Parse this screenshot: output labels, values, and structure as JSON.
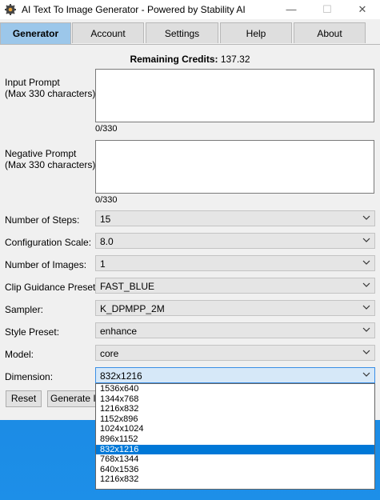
{
  "window": {
    "title": "AI Text To Image Generator - Powered by Stability AI",
    "minimize_glyph": "—",
    "maximize_glyph": "☐",
    "close_glyph": "✕"
  },
  "tabs": [
    {
      "label": "Generator",
      "active": true
    },
    {
      "label": "Account",
      "active": false
    },
    {
      "label": "Settings",
      "active": false
    },
    {
      "label": "Help",
      "active": false
    },
    {
      "label": "About",
      "active": false
    }
  ],
  "credits": {
    "label": "Remaining Credits:",
    "value": "137.32"
  },
  "input_prompt": {
    "label_line1": "Input Prompt",
    "label_line2": "(Max 330 characters):",
    "value": "",
    "counter": "0/330"
  },
  "negative_prompt": {
    "label_line1": "Negative Prompt",
    "label_line2": "(Max 330 characters):",
    "value": "",
    "counter": "0/330"
  },
  "fields": {
    "steps": {
      "label": "Number of Steps:",
      "value": "15"
    },
    "cfg": {
      "label": "Configuration Scale:",
      "value": "8.0"
    },
    "images": {
      "label": "Number of Images:",
      "value": "1"
    },
    "clip": {
      "label": "Clip Guidance Preset:",
      "value": "FAST_BLUE"
    },
    "sampler": {
      "label": "Sampler:",
      "value": "K_DPMPP_2M"
    },
    "style": {
      "label": "Style Preset:",
      "value": "enhance"
    },
    "model": {
      "label": "Model:",
      "value": "core"
    },
    "dimension": {
      "label": "Dimension:",
      "value": "832x1216"
    }
  },
  "buttons": {
    "reset": "Reset",
    "generate": "Generate Im"
  },
  "dimension_options": [
    "1536x640",
    "1344x768",
    "1216x832",
    "1152x896",
    "1024x1024",
    "896x1152",
    "832x1216",
    "768x1344",
    "640x1536",
    "1216x832"
  ],
  "dimension_selected_index": 6,
  "icons": {
    "dropdown": "chevron-down-icon",
    "app": "app-gear-icon"
  },
  "colors": {
    "active_tab": "#9cc7ea",
    "selection": "#0078d7",
    "desktop": "#1a86e0"
  }
}
